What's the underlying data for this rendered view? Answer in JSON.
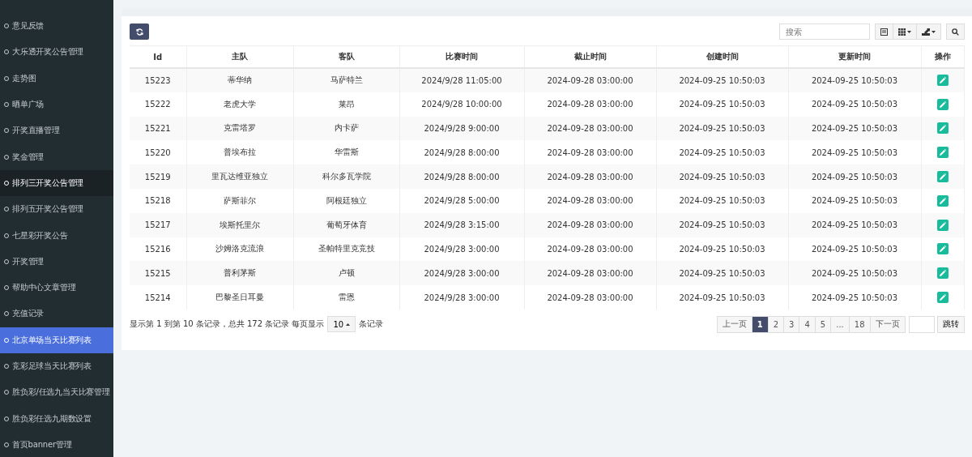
{
  "sidebar": {
    "items": [
      {
        "label": "意见反馈",
        "selected": false,
        "hovered": false
      },
      {
        "label": "大乐透开奖公告管理",
        "selected": false,
        "hovered": false
      },
      {
        "label": "走势图",
        "selected": false,
        "hovered": false
      },
      {
        "label": "晒单广场",
        "selected": false,
        "hovered": false
      },
      {
        "label": "开奖直播管理",
        "selected": false,
        "hovered": false
      },
      {
        "label": "奖金管理",
        "selected": false,
        "hovered": false
      },
      {
        "label": "排列三开奖公告管理",
        "selected": false,
        "hovered": true
      },
      {
        "label": "排列五开奖公告管理",
        "selected": false,
        "hovered": false
      },
      {
        "label": "七星彩开奖公告",
        "selected": false,
        "hovered": false
      },
      {
        "label": "开奖管理",
        "selected": false,
        "hovered": false
      },
      {
        "label": "帮助中心文章管理",
        "selected": false,
        "hovered": false
      },
      {
        "label": "充值记录",
        "selected": false,
        "hovered": false
      },
      {
        "label": "北京单场当天比赛列表",
        "selected": true,
        "hovered": false
      },
      {
        "label": "竞彩足球当天比赛列表",
        "selected": false,
        "hovered": false
      },
      {
        "label": "胜负彩/任选九当天比赛管理",
        "selected": false,
        "hovered": false
      },
      {
        "label": "胜负彩任选九期数设置",
        "selected": false,
        "hovered": false
      },
      {
        "label": "首页banner管理",
        "selected": false,
        "hovered": false
      }
    ]
  },
  "toolbar": {
    "search": {
      "placeholder": "搜索"
    }
  },
  "table": {
    "columns": [
      "Id",
      "主队",
      "客队",
      "比赛时间",
      "截止时间",
      "创建时间",
      "更新时间",
      "操作"
    ],
    "rows": [
      [
        "15223",
        "蒂华纳",
        "马萨特兰",
        "2024/9/28 11:05:00",
        "2024-09-28 03:00:00",
        "2024-09-25 10:50:03",
        "2024-09-25 10:50:03"
      ],
      [
        "15222",
        "老虎大学",
        "莱昂",
        "2024/9/28 10:00:00",
        "2024-09-28 03:00:00",
        "2024-09-25 10:50:03",
        "2024-09-25 10:50:03"
      ],
      [
        "15221",
        "克雷塔罗",
        "内卡萨",
        "2024/9/28 9:00:00",
        "2024-09-28 03:00:00",
        "2024-09-25 10:50:03",
        "2024-09-25 10:50:03"
      ],
      [
        "15220",
        "普埃布拉",
        "华雷斯",
        "2024/9/28 8:00:00",
        "2024-09-28 03:00:00",
        "2024-09-25 10:50:03",
        "2024-09-25 10:50:03"
      ],
      [
        "15219",
        "里瓦达维亚独立",
        "科尔多瓦学院",
        "2024/9/28 8:00:00",
        "2024-09-28 03:00:00",
        "2024-09-25 10:50:03",
        "2024-09-25 10:50:03"
      ],
      [
        "15218",
        "萨斯菲尔",
        "阿根廷独立",
        "2024/9/28 5:00:00",
        "2024-09-28 03:00:00",
        "2024-09-25 10:50:03",
        "2024-09-25 10:50:03"
      ],
      [
        "15217",
        "埃斯托里尔",
        "葡萄牙体育",
        "2024/9/28 3:15:00",
        "2024-09-28 03:00:00",
        "2024-09-25 10:50:03",
        "2024-09-25 10:50:03"
      ],
      [
        "15216",
        "沙姆洛克流浪",
        "圣帕特里克竞技",
        "2024/9/28 3:00:00",
        "2024-09-28 03:00:00",
        "2024-09-25 10:50:03",
        "2024-09-25 10:50:03"
      ],
      [
        "15215",
        "普利茅斯",
        "卢顿",
        "2024/9/28 3:00:00",
        "2024-09-28 03:00:00",
        "2024-09-25 10:50:03",
        "2024-09-25 10:50:03"
      ],
      [
        "15214",
        "巴黎圣日耳曼",
        "雷恩",
        "2024/9/28 3:00:00",
        "2024-09-28 03:00:00",
        "2024-09-25 10:50:03",
        "2024-09-25 10:50:03"
      ]
    ]
  },
  "footer": {
    "summary": "显示第 1 到第 10 条记录，总共 172 条记录 每页显示",
    "page_size": "10",
    "page_size_suffix": "条记录",
    "pages": [
      {
        "label": "上一页",
        "selected": false
      },
      {
        "label": "1",
        "selected": true
      },
      {
        "label": "2",
        "selected": false
      },
      {
        "label": "3",
        "selected": false
      },
      {
        "label": "4",
        "selected": false
      },
      {
        "label": "5",
        "selected": false
      },
      {
        "label": "...",
        "selected": false
      },
      {
        "label": "18",
        "selected": false
      },
      {
        "label": "下一页",
        "selected": false
      }
    ],
    "jump_button": "跳转"
  }
}
